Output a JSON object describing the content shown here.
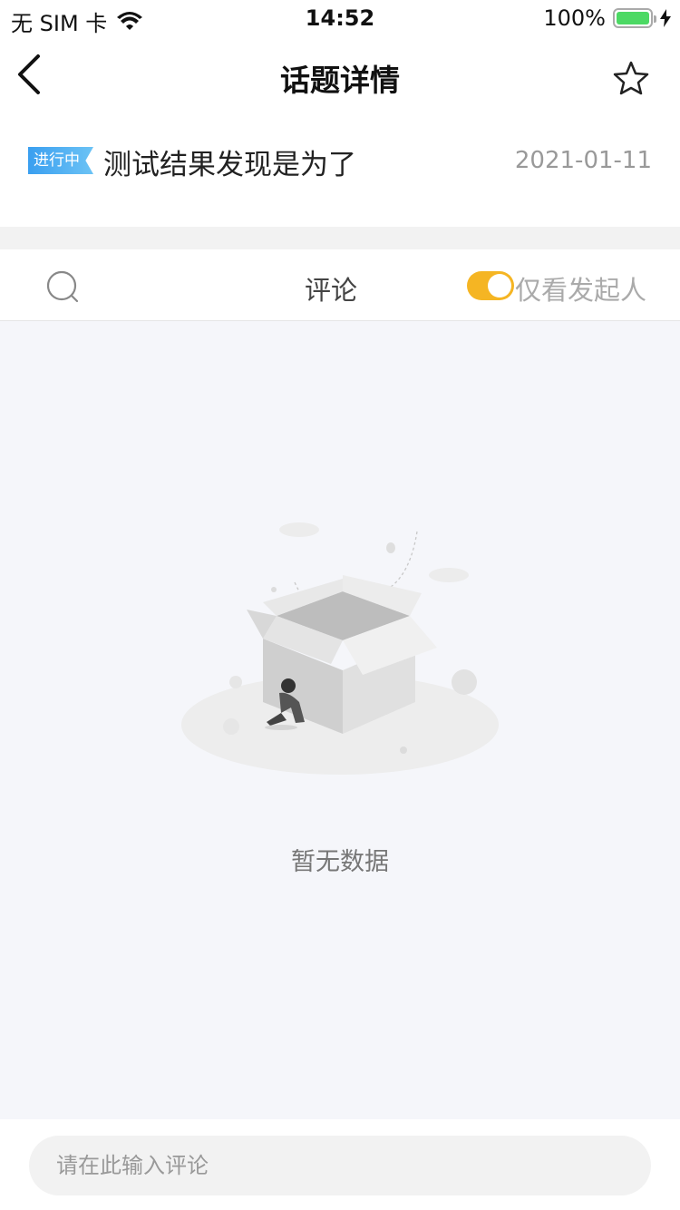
{
  "status_bar": {
    "carrier": "无 SIM 卡",
    "time": "14:52",
    "battery": "100%",
    "battery_color": "#4cd964"
  },
  "nav": {
    "title": "话题详情",
    "back_icon": "chevron-left-icon",
    "favorite_icon": "star-outline-icon"
  },
  "topic": {
    "status_tag": "进行中",
    "title": "测试结果发现是为了",
    "date": "2021-01-11",
    "tag_color": "#3a9ff0"
  },
  "comments_toolbar": {
    "search_icon": "search-icon",
    "tab_label": "评论",
    "toggle_on": true,
    "toggle_color": "#f5b523",
    "toggle_label": "仅看发起人"
  },
  "empty_state": {
    "message": "暂无数据",
    "illustration": "empty-box-illustration"
  },
  "comment_input": {
    "placeholder": "请在此输入评论",
    "value": ""
  }
}
